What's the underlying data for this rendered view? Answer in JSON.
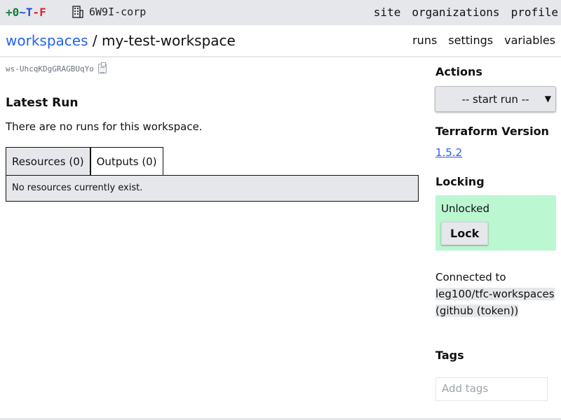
{
  "topbar": {
    "logo": {
      "plus": "+0",
      "tilde": "~T",
      "minus": "-F"
    },
    "org": "6W9I-corp",
    "nav": [
      "site",
      "organizations",
      "profile"
    ]
  },
  "header": {
    "breadcrumb_link": "workspaces",
    "separator": "/",
    "workspace_name": "my-test-workspace",
    "subnav": [
      "runs",
      "settings",
      "variables"
    ]
  },
  "main": {
    "workspace_id": "ws-UhcqKDgGRAGBUqYo",
    "latest_run_heading": "Latest Run",
    "no_runs_text": "There are no runs for this workspace.",
    "tabs": [
      {
        "label": "Resources (0)"
      },
      {
        "label": "Outputs (0)"
      }
    ],
    "resources_empty_text": "No resources currently exist."
  },
  "sidebar": {
    "actions_heading": "Actions",
    "start_run_selected": "-- start run --",
    "terraform_heading": "Terraform Version",
    "terraform_version": "1.5.2",
    "locking_heading": "Locking",
    "lock_state": "Unlocked",
    "lock_button": "Lock",
    "connected_prefix": "Connected to",
    "connected_repo": "leg100/tfc-workspaces (github (token))",
    "tags_heading": "Tags",
    "tags_placeholder": "Add tags"
  },
  "colors": {
    "link": "#2563eb",
    "topbar_bg": "#e5e7eb",
    "unlocked_bg": "#bbf7d0"
  }
}
